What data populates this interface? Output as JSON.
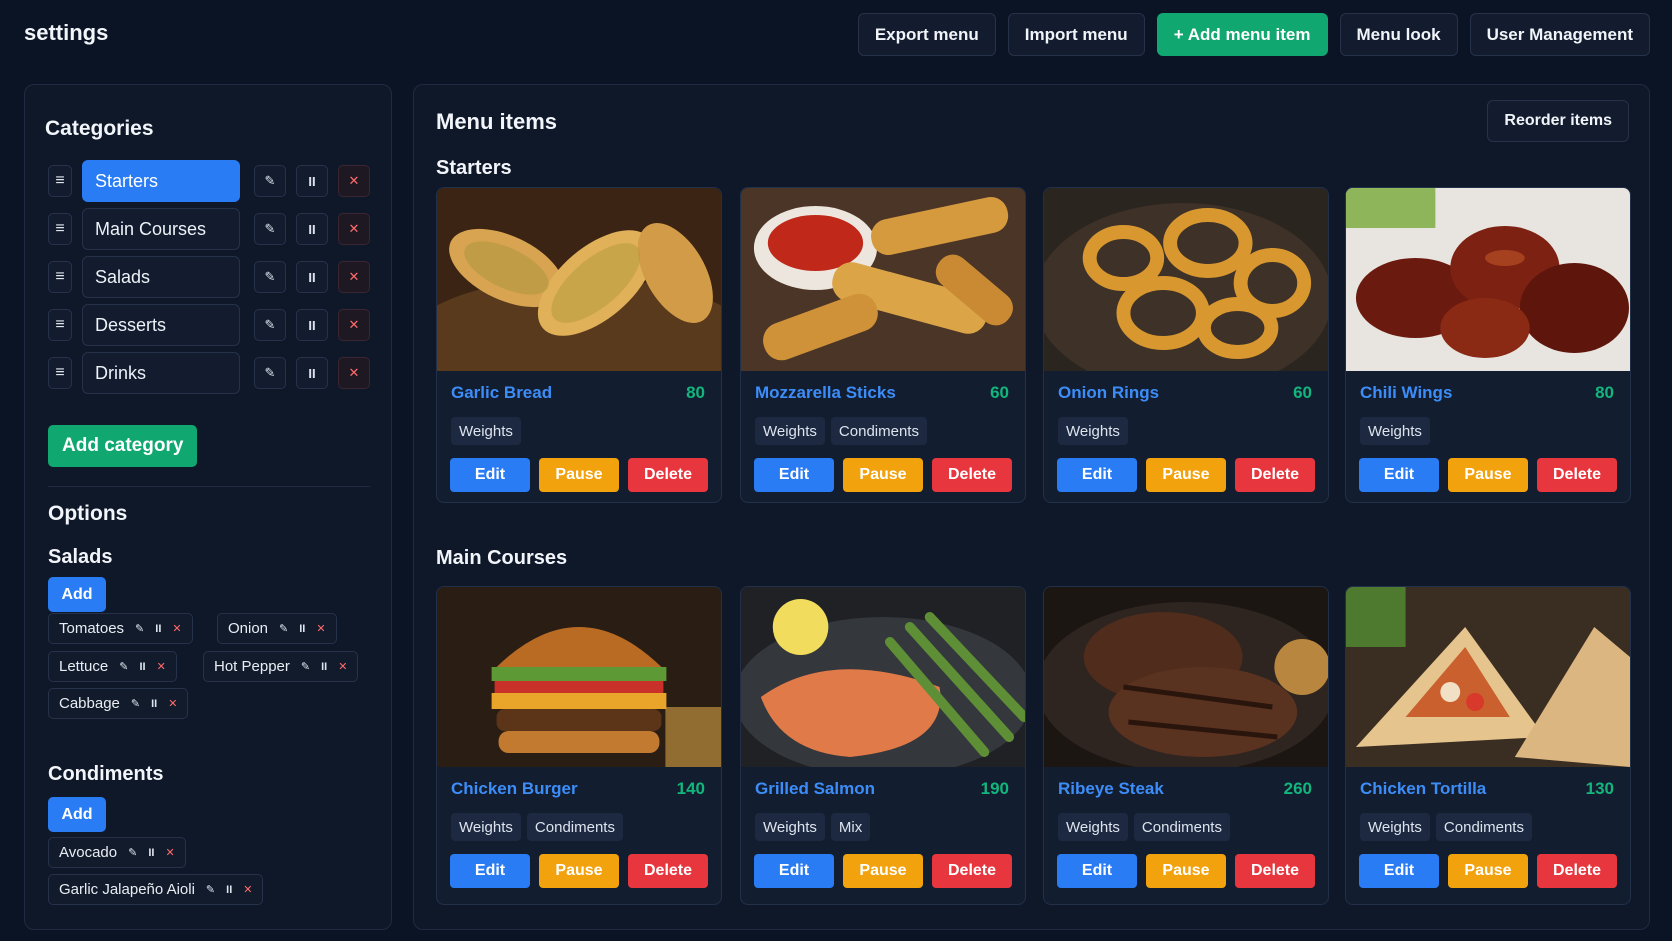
{
  "app": {
    "title": "settings"
  },
  "toolbar": {
    "export": "Export menu",
    "import": "Import menu",
    "add_item": "+ Add menu item",
    "menu_look": "Menu look",
    "user_management": "User Management"
  },
  "sidebar": {
    "categories_title": "Categories",
    "categories": [
      {
        "name": "Starters",
        "active": true
      },
      {
        "name": "Main Courses",
        "active": false
      },
      {
        "name": "Salads",
        "active": false
      },
      {
        "name": "Desserts",
        "active": false
      },
      {
        "name": "Drinks",
        "active": false
      }
    ],
    "add_category": "Add category",
    "options_title": "Options",
    "groups": [
      {
        "title": "Salads",
        "add": "Add",
        "options": [
          "Tomatoes",
          "Onion",
          "Lettuce",
          "Hot Pepper",
          "Cabbage"
        ]
      },
      {
        "title": "Condiments",
        "add": "Add",
        "options": [
          "Avocado",
          "Garlic Jalapeño Aioli"
        ]
      }
    ],
    "icons": {
      "drag": "≡",
      "edit": "✎",
      "pause": "II",
      "remove": "✕"
    }
  },
  "main": {
    "title": "Menu items",
    "reorder": "Reorder items",
    "button_labels": {
      "edit": "Edit",
      "pause": "Pause",
      "delete": "Delete"
    },
    "sections": [
      {
        "title": "Starters",
        "items": [
          {
            "name": "Garlic Bread",
            "price": "80",
            "tags": [
              "Weights"
            ]
          },
          {
            "name": "Mozzarella Sticks",
            "price": "60",
            "tags": [
              "Weights",
              "Condiments"
            ]
          },
          {
            "name": "Onion Rings",
            "price": "60",
            "tags": [
              "Weights"
            ]
          },
          {
            "name": "Chili Wings",
            "price": "80",
            "tags": [
              "Weights"
            ]
          }
        ]
      },
      {
        "title": "Main Courses",
        "items": [
          {
            "name": "Chicken Burger",
            "price": "140",
            "tags": [
              "Weights",
              "Condiments"
            ]
          },
          {
            "name": "Grilled Salmon",
            "price": "190",
            "tags": [
              "Weights",
              "Mix"
            ]
          },
          {
            "name": "Ribeye Steak",
            "price": "260",
            "tags": [
              "Weights",
              "Condiments"
            ]
          },
          {
            "name": "Chicken Tortilla",
            "price": "130",
            "tags": [
              "Weights",
              "Condiments"
            ]
          }
        ]
      }
    ]
  },
  "colors": {
    "background": "#0b1424",
    "primary": "#2a7cf5",
    "success": "#10a770",
    "warning": "#f2a20c",
    "danger": "#e8363f",
    "item_name": "#3d8df8",
    "price": "#12b67c"
  }
}
